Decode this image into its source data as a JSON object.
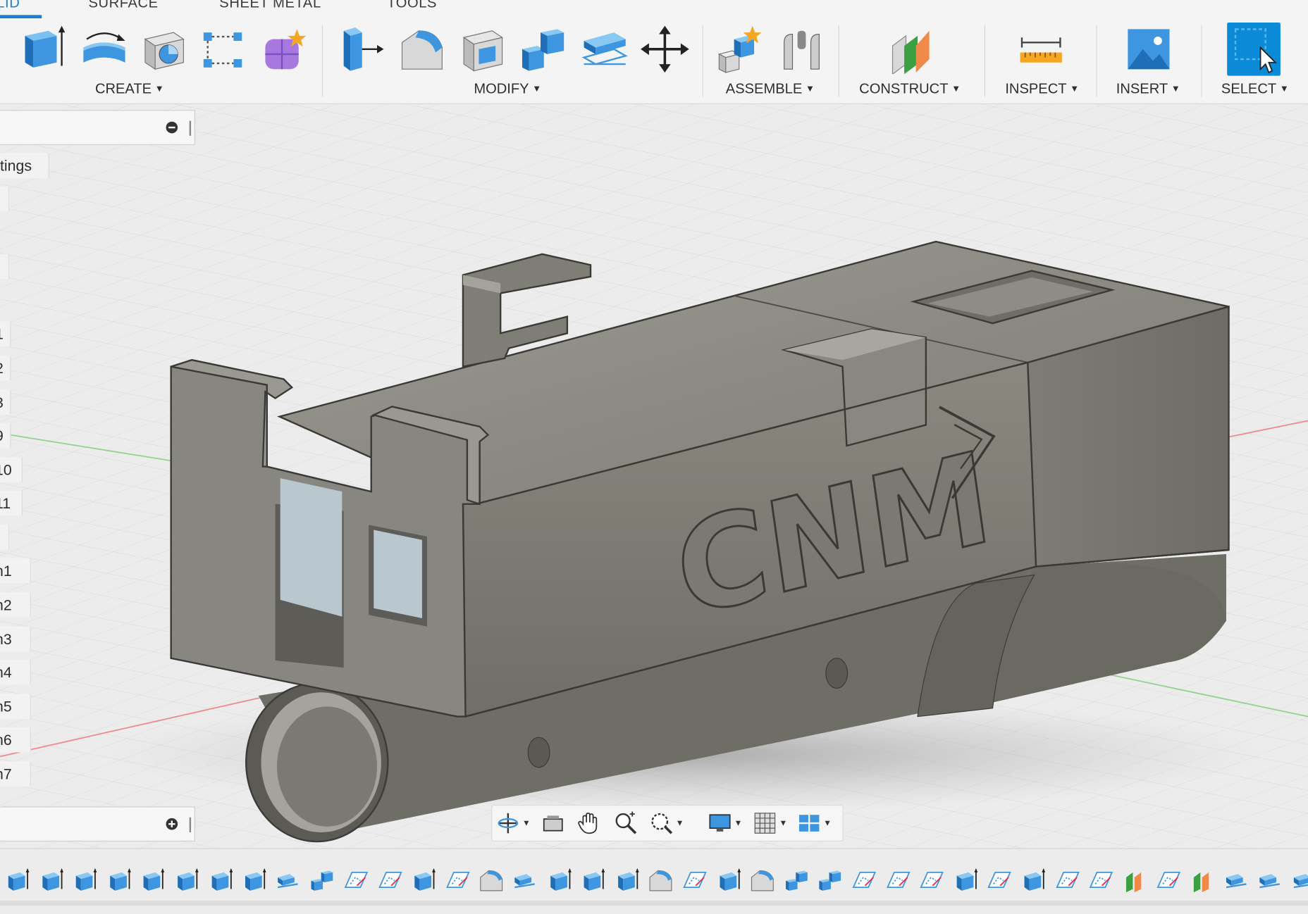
{
  "ribbon": {
    "tabs": [
      {
        "label": "LID",
        "active": true
      },
      {
        "label": "SURFACE",
        "active": false
      },
      {
        "label": "SHEET METAL",
        "active": false
      },
      {
        "label": "TOOLS",
        "active": false
      }
    ],
    "groups": {
      "create": "CREATE",
      "modify": "MODIFY",
      "assemble": "ASSEMBLE",
      "construct": "CONSTRUCT",
      "inspect": "INSPECT",
      "insert": "INSERT",
      "select": "SELECT"
    },
    "accent_color": "#1d7fd1",
    "select_color": "#0b8ad8"
  },
  "browser": {
    "settings_label": "tings",
    "items": [
      "1",
      "2",
      "3",
      "9",
      "10",
      "11",
      "n1",
      "n2",
      "n3",
      "n4",
      "n5",
      "n6",
      "n7"
    ]
  },
  "model": {
    "logo_text": "CNM",
    "body_color": "#838279"
  },
  "navbar": {
    "tools": [
      "orbit-icon",
      "look-at-icon",
      "pan-icon",
      "zoom-icon",
      "fit-icon",
      "display-settings-icon",
      "grid-settings-icon",
      "viewports-icon"
    ]
  },
  "timeline": {
    "features": [
      "extrude",
      "extrude",
      "extrude",
      "extrude",
      "extrude",
      "extrude",
      "extrude",
      "extrude",
      "split",
      "combine",
      "sketch",
      "sketch",
      "extrude",
      "sketch",
      "fillet",
      "split",
      "extrude",
      "extrude",
      "extrude",
      "fillet",
      "sketch",
      "extrude",
      "fillet",
      "combine",
      "combine",
      "sketch",
      "sketch",
      "sketch",
      "extrude",
      "sketch",
      "extrude",
      "sketch",
      "sketch",
      "plane",
      "sketch",
      "plane",
      "split",
      "split",
      "split"
    ]
  }
}
